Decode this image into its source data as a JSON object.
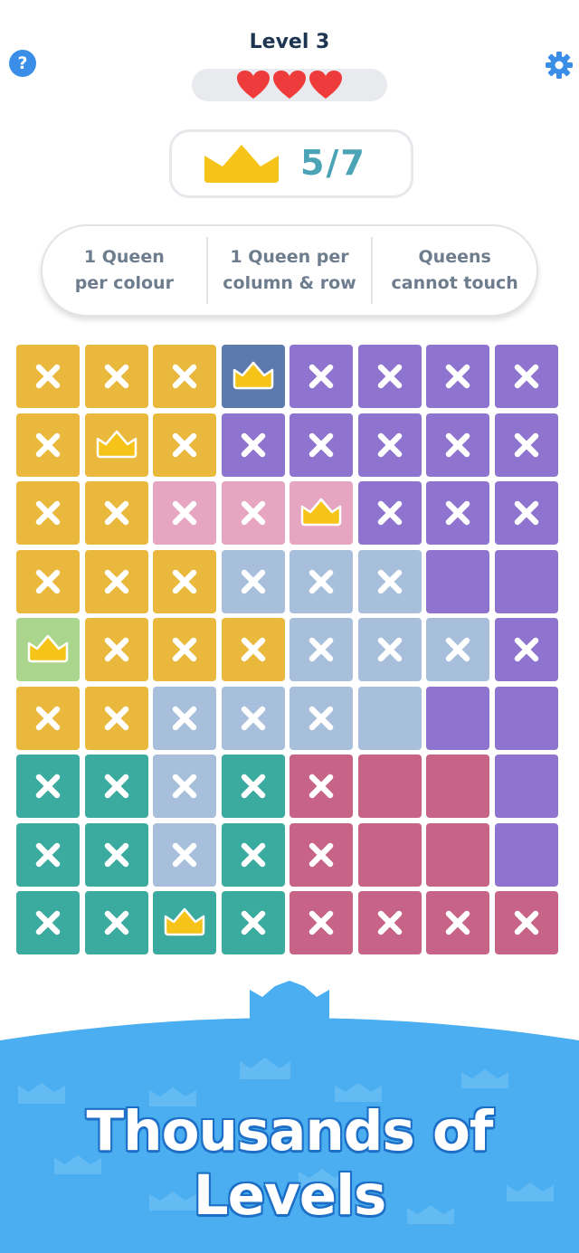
{
  "header": {
    "level_label": "Level 3",
    "help_label": "?",
    "lives": 3
  },
  "counter": {
    "text": "5/7"
  },
  "rules": [
    {
      "text": "1 Queen\nper colour"
    },
    {
      "text": "1 Queen per\ncolumn & row"
    },
    {
      "text": "Queens\ncannot touch"
    }
  ],
  "colors": {
    "Y": "#e9b83c",
    "P": "#8e74cf",
    "B": "#5c7aae",
    "K": "#e6a6c2",
    "L": "#a8bfdc",
    "G": "#a9d68c",
    "T": "#3bab9f",
    "R": "#c66386",
    "crown": "#f6c419",
    "heart": "#ee3b3b",
    "accent": "#3a8ee8",
    "banner": "#4aaef0"
  },
  "board": {
    "rows": [
      [
        "Y",
        "Y",
        "Y",
        "B",
        "P",
        "P",
        "P",
        "P"
      ],
      [
        "Y",
        "Y",
        "Y",
        "P",
        "P",
        "P",
        "P",
        "P"
      ],
      [
        "Y",
        "Y",
        "K",
        "K",
        "K",
        "P",
        "P",
        "P"
      ],
      [
        "Y",
        "Y",
        "Y",
        "L",
        "L",
        "L",
        "P",
        "P"
      ],
      [
        "G",
        "Y",
        "Y",
        "Y",
        "L",
        "L",
        "L",
        "P"
      ],
      [
        "Y",
        "Y",
        "L",
        "L",
        "L",
        "L",
        "P",
        "P"
      ],
      [
        "T",
        "T",
        "L",
        "T",
        "R",
        "R",
        "R",
        "P"
      ],
      [
        "T",
        "T",
        "L",
        "T",
        "R",
        "R",
        "R",
        "P"
      ],
      [
        "T",
        "T",
        "T",
        "T",
        "R",
        "R",
        "R",
        "R"
      ]
    ],
    "marks": [
      [
        "x",
        "x",
        "x",
        "q",
        "x",
        "x",
        "x",
        "x"
      ],
      [
        "x",
        "q",
        "x",
        "x",
        "x",
        "x",
        "x",
        "x"
      ],
      [
        "x",
        "x",
        "x",
        "x",
        "q",
        "x",
        "x",
        "x"
      ],
      [
        "x",
        "x",
        "x",
        "x",
        "x",
        "x",
        "",
        ""
      ],
      [
        "q",
        "x",
        "x",
        "x",
        "x",
        "x",
        "x",
        "x"
      ],
      [
        "x",
        "x",
        "x",
        "x",
        "x",
        "",
        "",
        ""
      ],
      [
        "x",
        "x",
        "x",
        "x",
        "x",
        "",
        "",
        ""
      ],
      [
        "x",
        "x",
        "x",
        "x",
        "x",
        "",
        "",
        ""
      ],
      [
        "x",
        "x",
        "q",
        "x",
        "x",
        "x",
        "x",
        "x"
      ]
    ]
  },
  "banner": {
    "tagline": "Thousands of Levels"
  }
}
